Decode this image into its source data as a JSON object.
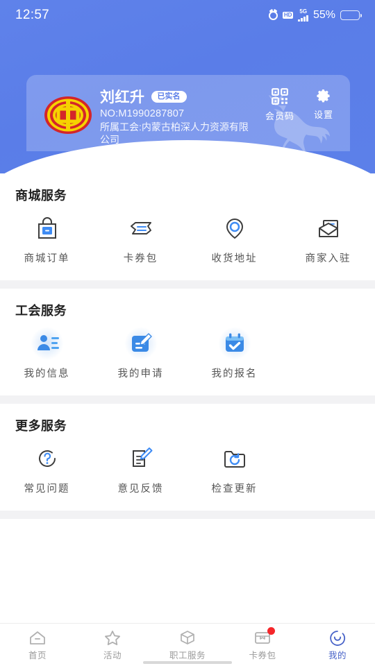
{
  "status_bar": {
    "time": "12:57",
    "hd_label": "HD",
    "network_label": "5G",
    "battery_percent": "55%",
    "battery_level": 55,
    "icons": [
      "alarm-icon",
      "hd-icon",
      "signal-5g-icon",
      "battery-icon"
    ]
  },
  "header": {
    "background_color": "#5c80e9",
    "watermark": "deer-watermark"
  },
  "user_card": {
    "avatar_icon": "union-emblem-logo",
    "name": "刘红升",
    "verified_badge": "已实名",
    "member_no": "NO:M1990287807",
    "organization": "所属工会:内蒙古柏深人力资源有限公司",
    "actions": [
      {
        "icon": "qrcode-icon",
        "label": "会员码"
      },
      {
        "icon": "gear-icon",
        "label": "设置"
      }
    ]
  },
  "sections": [
    {
      "title": "商城服务",
      "items": [
        {
          "icon": "shopping-bag-icon",
          "label": "商城订单"
        },
        {
          "icon": "coupon-ticket-icon",
          "label": "卡券包"
        },
        {
          "icon": "location-pin-icon",
          "label": "收货地址"
        },
        {
          "icon": "envelope-icon",
          "label": "商家入驻"
        }
      ]
    },
    {
      "title": "工会服务",
      "items": [
        {
          "icon": "user-info-icon",
          "label": "我的信息"
        },
        {
          "icon": "application-form-icon",
          "label": "我的申请"
        },
        {
          "icon": "calendar-check-icon",
          "label": "我的报名"
        }
      ]
    },
    {
      "title": "更多服务",
      "items": [
        {
          "icon": "question-circle-icon",
          "label": "常见问题"
        },
        {
          "icon": "feedback-document-icon",
          "label": "意见反馈"
        },
        {
          "icon": "folder-refresh-icon",
          "label": "检查更新"
        }
      ]
    }
  ],
  "tabbar": {
    "active_color": "#4762c8",
    "inactive_color": "#9b9b9b",
    "badge_color": "#f5262a",
    "tabs": [
      {
        "icon": "home-icon",
        "label": "首页",
        "active": false,
        "badge": false
      },
      {
        "icon": "star-icon",
        "label": "活动",
        "active": false,
        "badge": false
      },
      {
        "icon": "box-icon",
        "label": "职工服务",
        "active": false,
        "badge": false
      },
      {
        "icon": "coupon-card-icon",
        "label": "卡券包",
        "active": false,
        "badge": true
      },
      {
        "icon": "smiley-face-icon",
        "label": "我的",
        "active": true,
        "badge": false
      }
    ]
  }
}
